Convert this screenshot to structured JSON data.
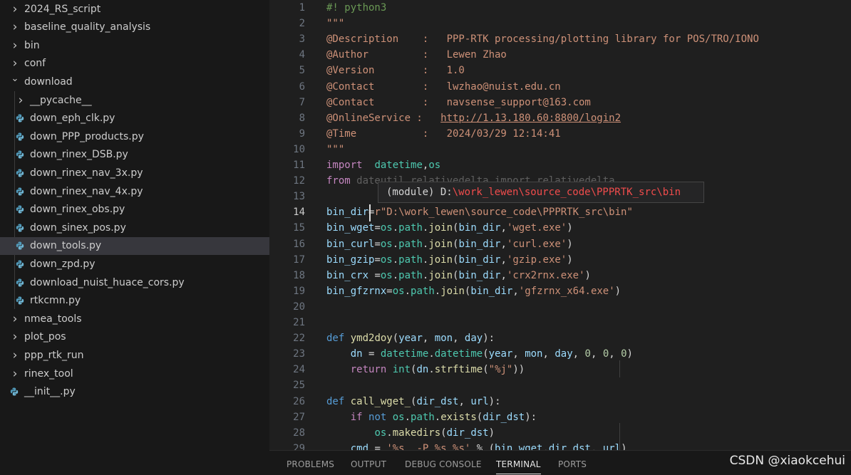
{
  "explorer": {
    "items": [
      {
        "label": "2024_RS_script",
        "type": "folder",
        "expanded": false,
        "depth": 0
      },
      {
        "label": "baseline_quality_analysis",
        "type": "folder",
        "expanded": false,
        "depth": 0
      },
      {
        "label": "bin",
        "type": "folder",
        "expanded": false,
        "depth": 0
      },
      {
        "label": "conf",
        "type": "folder",
        "expanded": false,
        "depth": 0
      },
      {
        "label": "download",
        "type": "folder",
        "expanded": true,
        "depth": 0
      },
      {
        "label": "__pycache__",
        "type": "folder",
        "expanded": false,
        "depth": 1
      },
      {
        "label": "down_eph_clk.py",
        "type": "file",
        "depth": 1
      },
      {
        "label": "down_PPP_products.py",
        "type": "file",
        "depth": 1
      },
      {
        "label": "down_rinex_DSB.py",
        "type": "file",
        "depth": 1
      },
      {
        "label": "down_rinex_nav_3x.py",
        "type": "file",
        "depth": 1
      },
      {
        "label": "down_rinex_nav_4x.py",
        "type": "file",
        "depth": 1
      },
      {
        "label": "down_rinex_obs.py",
        "type": "file",
        "depth": 1
      },
      {
        "label": "down_sinex_pos.py",
        "type": "file",
        "depth": 1
      },
      {
        "label": "down_tools.py",
        "type": "file",
        "depth": 1,
        "selected": true
      },
      {
        "label": "down_zpd.py",
        "type": "file",
        "depth": 1
      },
      {
        "label": "download_nuist_huace_cors.py",
        "type": "file",
        "depth": 1
      },
      {
        "label": "rtkcmn.py",
        "type": "file",
        "depth": 1
      },
      {
        "label": "nmea_tools",
        "type": "folder",
        "expanded": false,
        "depth": 0
      },
      {
        "label": "plot_pos",
        "type": "folder",
        "expanded": false,
        "depth": 0
      },
      {
        "label": "ppp_rtk_run",
        "type": "folder",
        "expanded": false,
        "depth": 0
      },
      {
        "label": "rinex_tool",
        "type": "folder",
        "expanded": false,
        "depth": 0
      },
      {
        "label": "__init__.py",
        "type": "file",
        "depth": 0
      }
    ]
  },
  "editor": {
    "active_line": 14,
    "lines": [
      {
        "n": "1",
        "tokens": [
          [
            "c-com",
            "#! python3"
          ]
        ]
      },
      {
        "n": "2",
        "tokens": [
          [
            "c-str",
            "\"\"\""
          ]
        ]
      },
      {
        "n": "3",
        "tokens": [
          [
            "c-str",
            "@Description    :   PPP-RTK processing/plotting library for POS/TRO/IONO"
          ]
        ]
      },
      {
        "n": "4",
        "tokens": [
          [
            "c-str",
            "@Author         :   Lewen Zhao"
          ]
        ]
      },
      {
        "n": "5",
        "tokens": [
          [
            "c-str",
            "@Version        :   1.0"
          ]
        ]
      },
      {
        "n": "6",
        "tokens": [
          [
            "c-str",
            "@Contact        :   lwzhao@nuist.edu.cn"
          ]
        ]
      },
      {
        "n": "7",
        "tokens": [
          [
            "c-str",
            "@Contact        :   navsense_support@163.com"
          ]
        ]
      },
      {
        "n": "8",
        "tokens": [
          [
            "c-str",
            "@OnlineService :   "
          ],
          [
            "c-link",
            "http://1.13.180.60:8800/login2"
          ]
        ]
      },
      {
        "n": "9",
        "tokens": [
          [
            "c-str",
            "@Time           :   2024/03/29 12:14:41"
          ]
        ]
      },
      {
        "n": "10",
        "tokens": [
          [
            "c-str",
            "\"\"\""
          ]
        ]
      },
      {
        "n": "11",
        "tokens": [
          [
            "c-ctl",
            "import"
          ],
          [
            "",
            "  "
          ],
          [
            "c-mod",
            "datetime"
          ],
          [
            "",
            ","
          ],
          [
            "c-mod",
            "os"
          ]
        ]
      },
      {
        "n": "12",
        "tokens": [
          [
            "c-ctl",
            "from"
          ],
          [
            "c-faded",
            " dateutil.relativedelta import relativedelta"
          ]
        ]
      },
      {
        "n": "13",
        "tokens": []
      },
      {
        "n": "14",
        "tokens": [
          [
            "c-var",
            "bin_dir"
          ],
          [
            "",
            "="
          ],
          [
            "c-str",
            "r\"D:\\work_lewen\\source_code\\PPPRTK_src\\bin\""
          ]
        ]
      },
      {
        "n": "15",
        "tokens": [
          [
            "c-var",
            "bin_wget"
          ],
          [
            "",
            "="
          ],
          [
            "c-mod",
            "os"
          ],
          [
            "",
            "."
          ],
          [
            "c-mod",
            "path"
          ],
          [
            "",
            "."
          ],
          [
            "c-fn",
            "join"
          ],
          [
            "",
            "("
          ],
          [
            "c-var",
            "bin_dir"
          ],
          [
            "",
            ","
          ],
          [
            "c-str",
            "'wget.exe'"
          ],
          [
            "",
            ")"
          ]
        ]
      },
      {
        "n": "16",
        "tokens": [
          [
            "c-var",
            "bin_curl"
          ],
          [
            "",
            "="
          ],
          [
            "c-mod",
            "os"
          ],
          [
            "",
            "."
          ],
          [
            "c-mod",
            "path"
          ],
          [
            "",
            "."
          ],
          [
            "c-fn",
            "join"
          ],
          [
            "",
            "("
          ],
          [
            "c-var",
            "bin_dir"
          ],
          [
            "",
            ","
          ],
          [
            "c-str",
            "'curl.exe'"
          ],
          [
            "",
            ")"
          ]
        ]
      },
      {
        "n": "17",
        "tokens": [
          [
            "c-var",
            "bin_gzip"
          ],
          [
            "",
            "="
          ],
          [
            "c-mod",
            "os"
          ],
          [
            "",
            "."
          ],
          [
            "c-mod",
            "path"
          ],
          [
            "",
            "."
          ],
          [
            "c-fn",
            "join"
          ],
          [
            "",
            "("
          ],
          [
            "c-var",
            "bin_dir"
          ],
          [
            "",
            ","
          ],
          [
            "c-str",
            "'gzip.exe'"
          ],
          [
            "",
            ")"
          ]
        ]
      },
      {
        "n": "18",
        "tokens": [
          [
            "c-var",
            "bin_crx"
          ],
          [
            "",
            " ="
          ],
          [
            "c-mod",
            "os"
          ],
          [
            "",
            "."
          ],
          [
            "c-mod",
            "path"
          ],
          [
            "",
            "."
          ],
          [
            "c-fn",
            "join"
          ],
          [
            "",
            "("
          ],
          [
            "c-var",
            "bin_dir"
          ],
          [
            "",
            ","
          ],
          [
            "c-str",
            "'crx2rnx.exe'"
          ],
          [
            "",
            ")"
          ]
        ]
      },
      {
        "n": "19",
        "tokens": [
          [
            "c-var",
            "bin_gfzrnx"
          ],
          [
            "",
            "="
          ],
          [
            "c-mod",
            "os"
          ],
          [
            "",
            "."
          ],
          [
            "c-mod",
            "path"
          ],
          [
            "",
            "."
          ],
          [
            "c-fn",
            "join"
          ],
          [
            "",
            "("
          ],
          [
            "c-var",
            "bin_dir"
          ],
          [
            "",
            ","
          ],
          [
            "c-str",
            "'gfzrnx_x64.exe'"
          ],
          [
            "",
            ")"
          ]
        ]
      },
      {
        "n": "20",
        "tokens": []
      },
      {
        "n": "21",
        "tokens": []
      },
      {
        "n": "22",
        "tokens": [
          [
            "c-kw",
            "def"
          ],
          [
            "",
            "",
            " "
          ],
          [
            "c-fn",
            "ymd2doy"
          ],
          [
            "",
            "("
          ],
          [
            "c-var",
            "year"
          ],
          [
            "",
            ", "
          ],
          [
            "c-var",
            "mon"
          ],
          [
            "",
            ", "
          ],
          [
            "c-var",
            "day"
          ],
          [
            "",
            "):"
          ]
        ]
      },
      {
        "n": "23",
        "tokens": [
          [
            "",
            "    "
          ],
          [
            "c-var",
            "dn"
          ],
          [
            "",
            " = "
          ],
          [
            "c-mod",
            "datetime"
          ],
          [
            "",
            "."
          ],
          [
            "c-mod",
            "datetime"
          ],
          [
            "",
            "("
          ],
          [
            "c-var",
            "year"
          ],
          [
            "",
            ", "
          ],
          [
            "c-var",
            "mon"
          ],
          [
            "",
            ", "
          ],
          [
            "c-var",
            "day"
          ],
          [
            "",
            ", "
          ],
          [
            "c-num",
            "0"
          ],
          [
            "",
            ", "
          ],
          [
            "c-num",
            "0"
          ],
          [
            "",
            ", "
          ],
          [
            "c-num",
            "0"
          ],
          [
            "",
            ")"
          ]
        ]
      },
      {
        "n": "24",
        "tokens": [
          [
            "",
            "    "
          ],
          [
            "c-ctl",
            "return"
          ],
          [
            "",
            " "
          ],
          [
            "c-mod",
            "int"
          ],
          [
            "",
            "("
          ],
          [
            "c-var",
            "dn"
          ],
          [
            "",
            "."
          ],
          [
            "c-fn",
            "strftime"
          ],
          [
            "",
            "("
          ],
          [
            "c-str",
            "\"%j\""
          ],
          [
            "",
            "))"
          ]
        ]
      },
      {
        "n": "25",
        "tokens": []
      },
      {
        "n": "26",
        "tokens": [
          [
            "c-kw",
            "def"
          ],
          [
            "",
            " "
          ],
          [
            "c-fn",
            "call_wget_"
          ],
          [
            "",
            "("
          ],
          [
            "c-var",
            "dir_dst"
          ],
          [
            "",
            ", "
          ],
          [
            "c-var",
            "url"
          ],
          [
            "",
            "):"
          ]
        ]
      },
      {
        "n": "27",
        "tokens": [
          [
            "",
            "    "
          ],
          [
            "c-ctl",
            "if"
          ],
          [
            "",
            " "
          ],
          [
            "c-kw",
            "not"
          ],
          [
            "",
            " "
          ],
          [
            "c-mod",
            "os"
          ],
          [
            "",
            "."
          ],
          [
            "c-mod",
            "path"
          ],
          [
            "",
            "."
          ],
          [
            "c-fn",
            "exists"
          ],
          [
            "",
            "("
          ],
          [
            "c-var",
            "dir_dst"
          ],
          [
            "",
            "):"
          ]
        ]
      },
      {
        "n": "28",
        "tokens": [
          [
            "",
            "        "
          ],
          [
            "c-mod",
            "os"
          ],
          [
            "",
            "."
          ],
          [
            "c-fn",
            "makedirs"
          ],
          [
            "",
            "("
          ],
          [
            "c-var",
            "dir_dst"
          ],
          [
            "",
            ")"
          ]
        ]
      },
      {
        "n": "29",
        "tokens": [
          [
            "",
            "    "
          ],
          [
            "c-var",
            "cmd"
          ],
          [
            "",
            " = "
          ],
          [
            "c-str",
            "'%s  -P %s %s'"
          ],
          [
            "",
            " % ("
          ],
          [
            "c-var",
            "bin_wget"
          ],
          [
            "",
            ","
          ],
          [
            "c-var",
            "dir_dst"
          ],
          [
            "",
            ", "
          ],
          [
            "c-var",
            "url"
          ],
          [
            "",
            ")"
          ]
        ]
      }
    ]
  },
  "hover": {
    "prefix": "(module) ",
    "path_drive": "D:",
    "path_rest": "\\work_lewen\\source_code\\PPPRTK_src\\bin"
  },
  "panel": {
    "tabs": [
      "PROBLEMS",
      "OUTPUT",
      "DEBUG CONSOLE",
      "TERMINAL",
      "PORTS"
    ],
    "active": "TERMINAL"
  },
  "watermark": "CSDN @xiaokcehui",
  "colors": {
    "keyword": "#569cd6",
    "control": "#c586c0",
    "function": "#dcdcaa",
    "variable": "#9cdcfe",
    "module": "#4ec9b0",
    "string": "#ce9178",
    "comment": "#6a9955",
    "python_icon": "#519aba"
  }
}
